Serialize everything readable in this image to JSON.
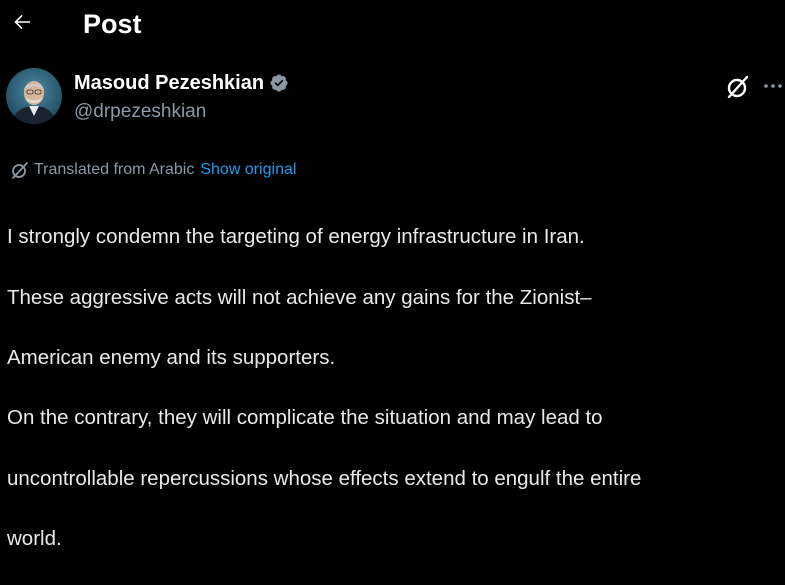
{
  "header": {
    "back_label": "Back",
    "title": "Post"
  },
  "author": {
    "display_name": "Masoud Pezeshkian",
    "handle": "@drpezeshkian",
    "verified": true
  },
  "translation": {
    "label": "Translated from Arabic",
    "show_original_label": "Show original"
  },
  "post": {
    "text_lines": [
      "I strongly condemn the targeting of energy infrastructure in Iran.",
      "These aggressive acts will not achieve any gains for the Zionist–",
      "American enemy and its supporters.",
      "On the contrary, they will complicate the situation and may lead to",
      "uncontrollable repercussions whose effects extend to engulf the entire",
      "world."
    ]
  },
  "icons": {
    "back": "arrow-left-icon",
    "verified": "verified-badge-icon",
    "grok": "grok-icon",
    "more": "more-icon",
    "translate": "grok-translate-icon"
  },
  "colors": {
    "background": "#000000",
    "text": "#e7e9ea",
    "secondary_text": "#8b98a5",
    "accent": "#1d9bf0"
  }
}
